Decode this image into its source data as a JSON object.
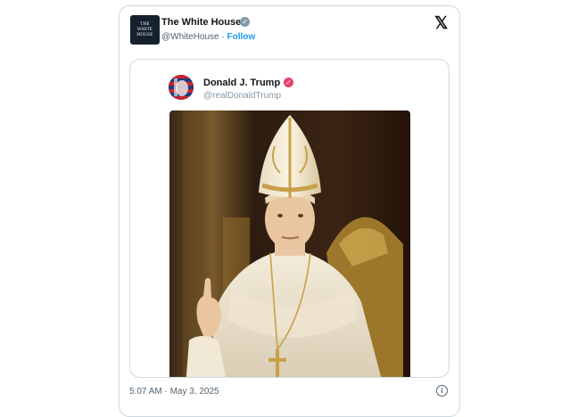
{
  "post": {
    "author_name": "The White House",
    "avatar_text": [
      "THE",
      "WHITE",
      "HOUSE"
    ],
    "handle": "@WhiteHouse",
    "separator": "·",
    "follow_label": "Follow",
    "timestamp": "5:07 AM · May 3, 2025"
  },
  "quoted": {
    "author_name": "Donald J. Trump",
    "handle": "@realDonaldTrump"
  },
  "icons": {
    "platform": "x-logo-icon",
    "verified_author": "gray-verified-badge-icon",
    "verified_quoted": "pink-verified-badge-icon",
    "info": "info-icon"
  },
  "colors": {
    "follow": "#1d9bf0",
    "border": "#cfd9de",
    "secondary_text": "#536471",
    "quoted_badge": "#e8436a"
  }
}
